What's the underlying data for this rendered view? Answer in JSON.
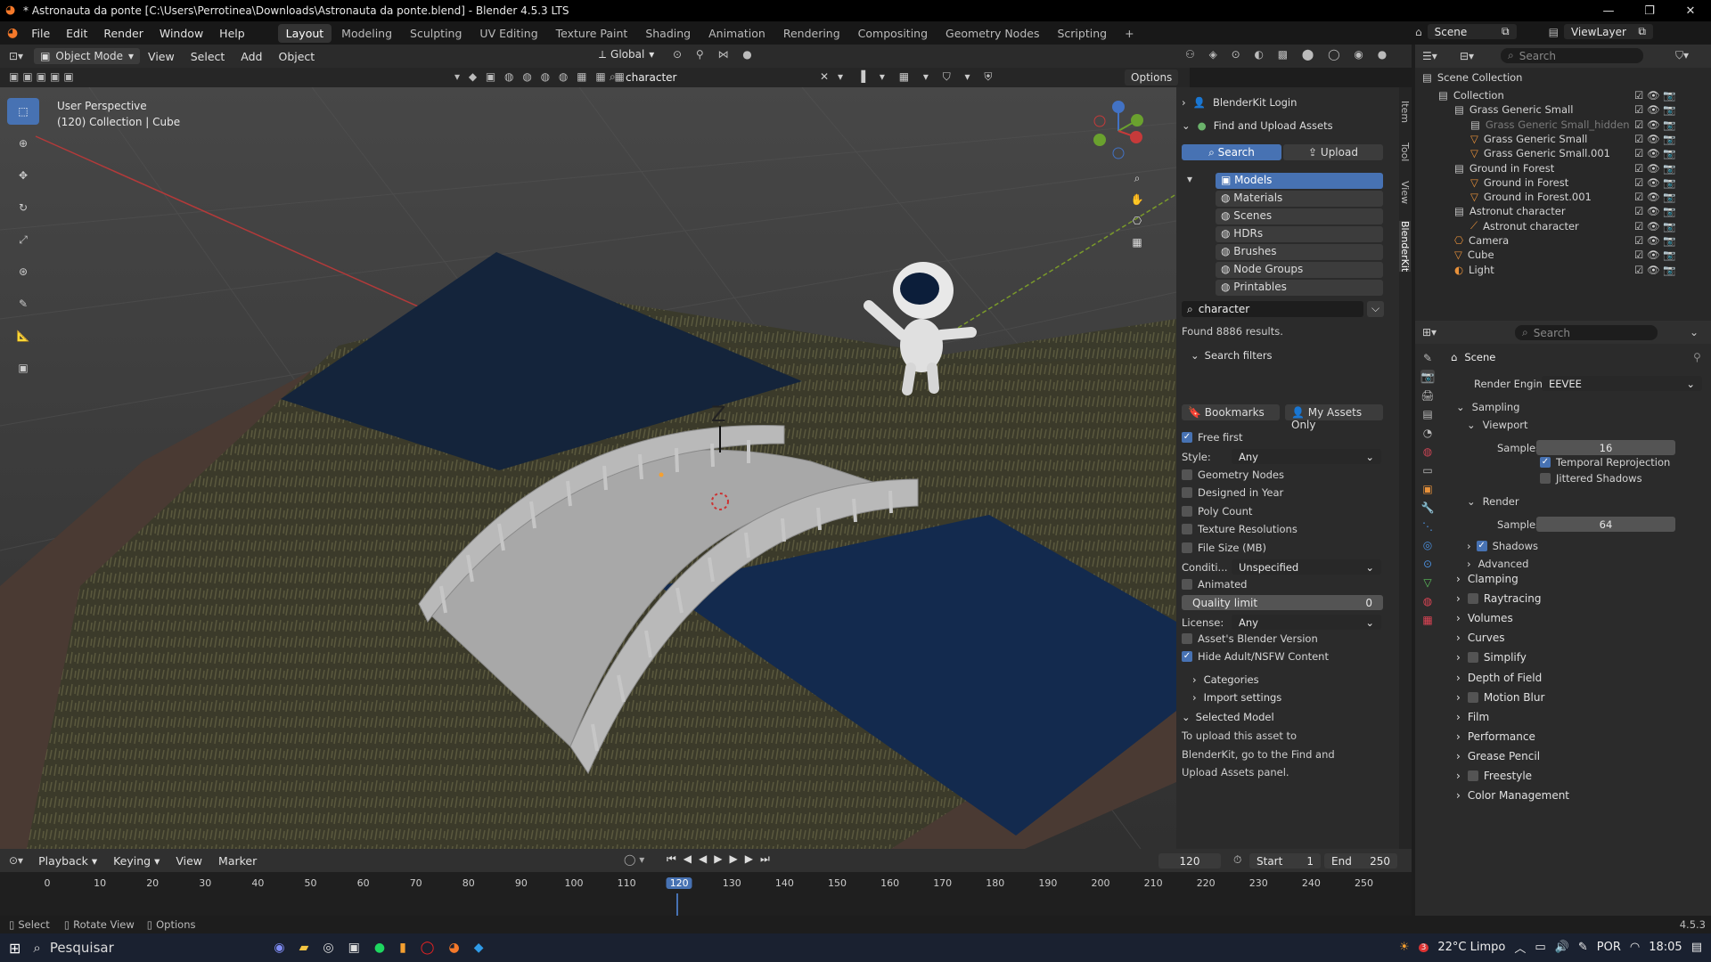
{
  "window": {
    "title": "* Astronauta da ponte [C:\\Users\\Perrotinea\\Downloads\\Astronauta da ponte.blend] - Blender 4.5.3 LTS"
  },
  "menu": [
    "File",
    "Edit",
    "Render",
    "Window",
    "Help"
  ],
  "workspaces": [
    "Layout",
    "Modeling",
    "Sculpting",
    "UV Editing",
    "Texture Paint",
    "Shading",
    "Animation",
    "Rendering",
    "Compositing",
    "Geometry Nodes",
    "Scripting"
  ],
  "scene_selector": {
    "scene": "Scene",
    "view_layer": "ViewLayer"
  },
  "viewport_header": {
    "mode": "Object Mode",
    "items": [
      "View",
      "Select",
      "Add",
      "Object"
    ],
    "orientation": "Global",
    "options": "Options"
  },
  "viewport": {
    "perspective": "User Perspective",
    "collection": "(120) Collection | Cube",
    "gizmo_z": "Z"
  },
  "blenderkit_search": {
    "query": "character"
  },
  "blenderkit": {
    "login": "BlenderKit Login",
    "find_upload": "Find and Upload Assets",
    "search_tab": "Search",
    "upload_tab": "Upload",
    "asset_types": [
      "Models",
      "Materials",
      "Scenes",
      "HDRs",
      "Brushes",
      "Node Groups",
      "Printables"
    ],
    "search_text": "character",
    "found": "Found 8886 results.",
    "search_filters": "Search filters",
    "bookmarks": "Bookmarks",
    "my_assets": "My Assets Only",
    "free_first": "Free first",
    "style_label": "Style:",
    "style_value": "Any",
    "geometry_nodes": "Geometry Nodes",
    "designed_in_year": "Designed in Year",
    "poly_count": "Poly Count",
    "texture_resolutions": "Texture Resolutions",
    "file_size": "File Size (MB)",
    "condition_label": "Conditi...",
    "condition_value": "Unspecified",
    "animated": "Animated",
    "quality_limit_label": "Quality limit",
    "quality_limit_value": "0",
    "license_label": "License:",
    "license_value": "Any",
    "blender_version": "Asset's Blender Version",
    "hide_nsfw": "Hide Adult/NSFW Content",
    "categories": "Categories",
    "import_settings": "Import settings",
    "selected_model": "Selected Model",
    "upload_text_1": "To upload this asset to",
    "upload_text_2": "BlenderKit, go to the Find and",
    "upload_text_3": "Upload Assets panel."
  },
  "side_tabs": [
    "Item",
    "Tool",
    "View",
    "BlenderKit"
  ],
  "outliner": {
    "search_placeholder": "Search",
    "root": "Scene Collection",
    "rows": [
      {
        "label": "Collection",
        "indent": 1,
        "icon": "collection-icon"
      },
      {
        "label": "Grass Generic Small",
        "indent": 2,
        "icon": "collection-icon"
      },
      {
        "label": "Grass Generic Small_hidden",
        "indent": 3,
        "icon": "collection-icon",
        "dim": true
      },
      {
        "label": "Grass Generic Small",
        "indent": 3,
        "icon": "mesh-icon"
      },
      {
        "label": "Grass Generic Small.001",
        "indent": 3,
        "icon": "mesh-icon"
      },
      {
        "label": "Ground in Forest",
        "indent": 2,
        "icon": "collection-icon"
      },
      {
        "label": "Ground in Forest",
        "indent": 3,
        "icon": "mesh-icon"
      },
      {
        "label": "Ground in Forest.001",
        "indent": 3,
        "icon": "mesh-icon"
      },
      {
        "label": "Astronut character",
        "indent": 2,
        "icon": "collection-icon"
      },
      {
        "label": "Astronut character",
        "indent": 3,
        "icon": "armature-icon"
      },
      {
        "label": "Camera",
        "indent": 2,
        "icon": "camera-icon"
      },
      {
        "label": "Cube",
        "indent": 2,
        "icon": "mesh-icon"
      },
      {
        "label": "Light",
        "indent": 2,
        "icon": "light-icon"
      }
    ]
  },
  "properties": {
    "search_placeholder": "Search",
    "context": "Scene",
    "render_engine_label": "Render Engine",
    "render_engine": "EEVEE",
    "sampling": "Sampling",
    "viewport": "Viewport",
    "samples_label": "Samples",
    "viewport_samples": "16",
    "temporal_reprojection": "Temporal Reprojection",
    "jittered_shadows": "Jittered Shadows",
    "render": "Render",
    "render_samples": "64",
    "shadows": "Shadows",
    "advanced": "Advanced",
    "sections": [
      "Clamping",
      "Raytracing",
      "Volumes",
      "Curves",
      "Simplify",
      "Depth of Field",
      "Motion Blur",
      "Film",
      "Performance",
      "Grease Pencil",
      "Freestyle",
      "Color Management"
    ]
  },
  "timeline": {
    "menus": [
      "Playback",
      "Keying",
      "View",
      "Marker"
    ],
    "current_frame": "120",
    "start_label": "Start",
    "start": "1",
    "end_label": "End",
    "end": "250",
    "ticks": [
      "0",
      "10",
      "20",
      "30",
      "40",
      "50",
      "60",
      "70",
      "80",
      "90",
      "100",
      "110",
      "120",
      "130",
      "140",
      "150",
      "160",
      "170",
      "180",
      "190",
      "200",
      "210",
      "220",
      "230",
      "240",
      "250"
    ]
  },
  "statusbar": {
    "select": "Select",
    "rotate": "Rotate View",
    "options": "Options",
    "version": "4.5.3"
  },
  "taskbar": {
    "search": "Pesquisar",
    "weather": "22°C  Limpo",
    "lang": "POR",
    "time": "18:05",
    "notif": "3"
  }
}
